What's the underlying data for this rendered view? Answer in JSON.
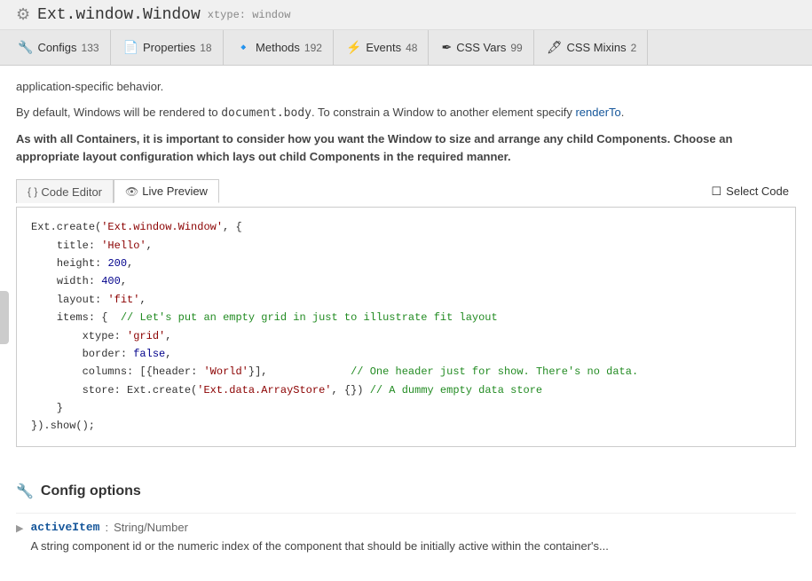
{
  "header": {
    "gear_icon": "⚙",
    "title": "Ext.window.Window",
    "xtype_label": "xtype: window"
  },
  "nav": {
    "tabs": [
      {
        "id": "configs",
        "icon": "🔧",
        "label": "Configs",
        "count": "133"
      },
      {
        "id": "properties",
        "icon": "📄",
        "label": "Properties",
        "count": "18"
      },
      {
        "id": "methods",
        "icon": "🔹",
        "label": "Methods",
        "count": "192"
      },
      {
        "id": "events",
        "icon": "⚡",
        "label": "Events",
        "count": "48"
      },
      {
        "id": "css-vars",
        "icon": "✒",
        "label": "CSS Vars",
        "count": "99"
      },
      {
        "id": "css-mixins",
        "icon": "🖋",
        "label": "CSS Mixins",
        "count": "2"
      }
    ]
  },
  "description": {
    "line1": "application-specific behavior.",
    "line2": "By default, Windows will be rendered to document.body. To constrain a Window to another element specify renderTo.",
    "line3": "As with all Containers, it is important to consider how you want the Window to size and arrange any child Components. Choose an appropriate layout configuration which lays out child Components in the required manner."
  },
  "code_toolbar": {
    "editor_label": "Code Editor",
    "preview_label": "Live Preview",
    "select_code_label": "Select Code"
  },
  "code_block": {
    "lines": [
      "Ext.create('Ext.window.Window', {",
      "    title: 'Hello',",
      "    height: 200,",
      "    width: 400,",
      "    layout: 'fit',",
      "    items: {  // Let's put an empty grid in just to illustrate fit layout",
      "        xtype: 'grid',",
      "        border: false,",
      "        columns: [{header: 'World'}],             // One header just for show. There's no data.",
      "        store: Ext.create('Ext.data.ArrayStore', {}) // A dummy empty data store",
      "    }",
      "}).show();"
    ]
  },
  "config_section": {
    "icon": "🔧",
    "title": "Config options",
    "items": [
      {
        "name": "activeItem",
        "separator": " : ",
        "type": "String/Number",
        "description": "A string component id or the numeric index of the component that should be initially active within the container's..."
      }
    ]
  }
}
